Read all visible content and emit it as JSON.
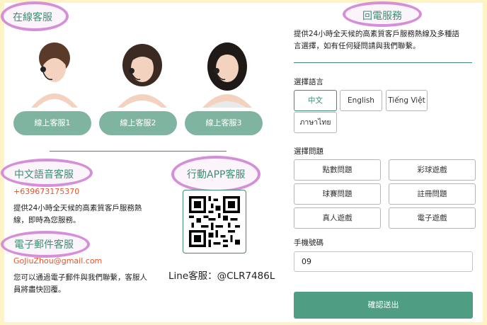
{
  "colors": {
    "accent": "#3c8f74",
    "button": "#7fb5a0",
    "submit": "#4f9e84",
    "highlight": "#d58fd9",
    "phone_text": "#e1562c",
    "background": "#fdf3c4"
  },
  "online": {
    "title": "在線客服",
    "agents": [
      {
        "label": "線上客服1",
        "avatar": "agent-avatar-1"
      },
      {
        "label": "線上客服2",
        "avatar": "agent-avatar-2"
      },
      {
        "label": "線上客服3",
        "avatar": "agent-avatar-3"
      }
    ]
  },
  "voice": {
    "title": "中文語音客服",
    "phone": "+639673175370",
    "desc_line1": "提供24小時全天候的高素質客戶服務熱",
    "desc_line2": "線，即時為您服務。"
  },
  "email": {
    "title": "電子郵件客服",
    "address": "GoJiuZhou@gmail.com",
    "desc_line1": "您可以通過電子郵件與我們聯繫，客服人",
    "desc_line2": "員將盡快回覆。"
  },
  "app": {
    "title": "行動APP客服",
    "qr_icon": "qr-code-icon",
    "line_id": "Line客服：@CLR7486L"
  },
  "callback": {
    "title": "回電服務",
    "desc_line1": "提供24小時全天候的高素質客戶服務熱線及多種語",
    "desc_line2": "言選擇，如有任何疑問請與我們聯繫。",
    "language_label": "選擇語言",
    "languages": [
      "中文",
      "English",
      "Tiếng Việt",
      "ภาษาไทย"
    ],
    "selected_language": "中文",
    "question_label": "選擇問題",
    "questions": [
      "點數問題",
      "彩球遊戲",
      "球賽問題",
      "註冊問題",
      "真人遊戲",
      "電子遊戲"
    ],
    "phone_label": "手機號碼",
    "phone_value": "09",
    "submit_label": "確認送出"
  }
}
